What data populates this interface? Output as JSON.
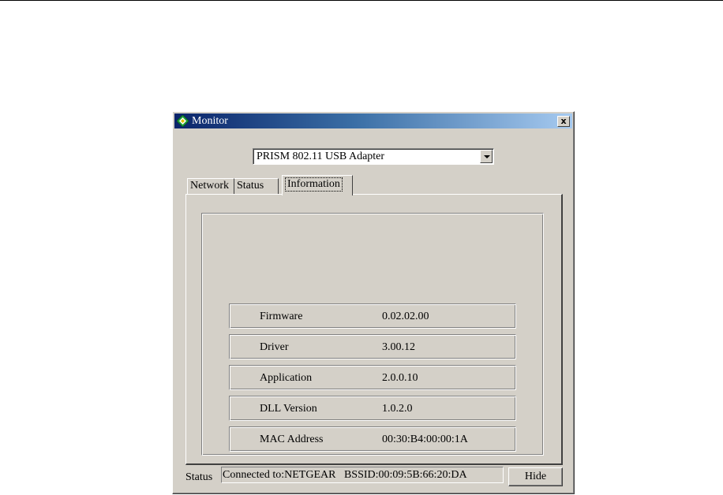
{
  "window": {
    "title": "Monitor",
    "icon": "diamond-app-icon",
    "close_label": "x"
  },
  "adapter_select": {
    "selected": "PRISM 802.11 USB Adapter"
  },
  "tabs": [
    {
      "label": "Network",
      "active": false
    },
    {
      "label": "Status",
      "active": false
    },
    {
      "label": "Information",
      "active": true
    }
  ],
  "information": {
    "rows": [
      {
        "label": "Firmware",
        "value": "0.02.02.00"
      },
      {
        "label": "Driver",
        "value": "3.00.12"
      },
      {
        "label": "Application",
        "value": "2.0.0.10"
      },
      {
        "label": "DLL Version",
        "value": "1.0.2.0"
      },
      {
        "label": "MAC Address",
        "value": "00:30:B4:00:00:1A"
      }
    ]
  },
  "status_bar": {
    "label": "Status",
    "text": "Connected to:NETGEAR   BSSID:00:09:5B:66:20:DA",
    "hide_label": "Hide"
  },
  "colors": {
    "face": "#d4d0c8",
    "titlebar_start": "#0a246a",
    "titlebar_end": "#a6caf0"
  }
}
